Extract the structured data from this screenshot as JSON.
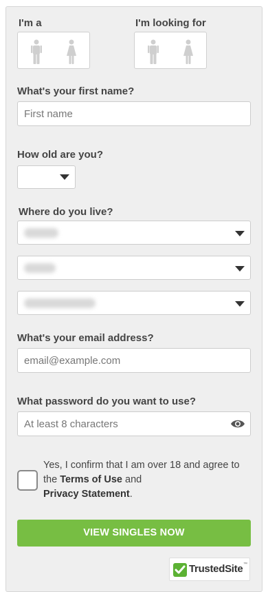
{
  "gender": {
    "im_a_label": "I'm a",
    "looking_for_label": "I'm looking for"
  },
  "first_name": {
    "label": "What's your first name?",
    "placeholder": "First name"
  },
  "age": {
    "label": "How old are you?",
    "value": ""
  },
  "location": {
    "label": "Where do you live?",
    "country_value": "",
    "region_value": "",
    "city_value": ""
  },
  "email": {
    "label": "What's your email address?",
    "placeholder": "email@example.com"
  },
  "password": {
    "label": "What password do you want to use?",
    "placeholder": "At least 8 characters"
  },
  "consent": {
    "text_before": "Yes, I confirm that I am over 18 and agree to the ",
    "terms_link": "Terms of Use",
    "text_and": " and ",
    "privacy_link": "Privacy Statement",
    "text_end": "."
  },
  "cta": {
    "label": "VIEW SINGLES NOW"
  },
  "badge": {
    "label": "TrustedSite",
    "tm": "™"
  },
  "colors": {
    "accent": "#77be43",
    "panel": "#efefef",
    "badge_green": "#5cb234"
  },
  "icons": [
    "male-icon",
    "female-icon",
    "eye-icon",
    "chevron-down-icon",
    "check-icon"
  ]
}
